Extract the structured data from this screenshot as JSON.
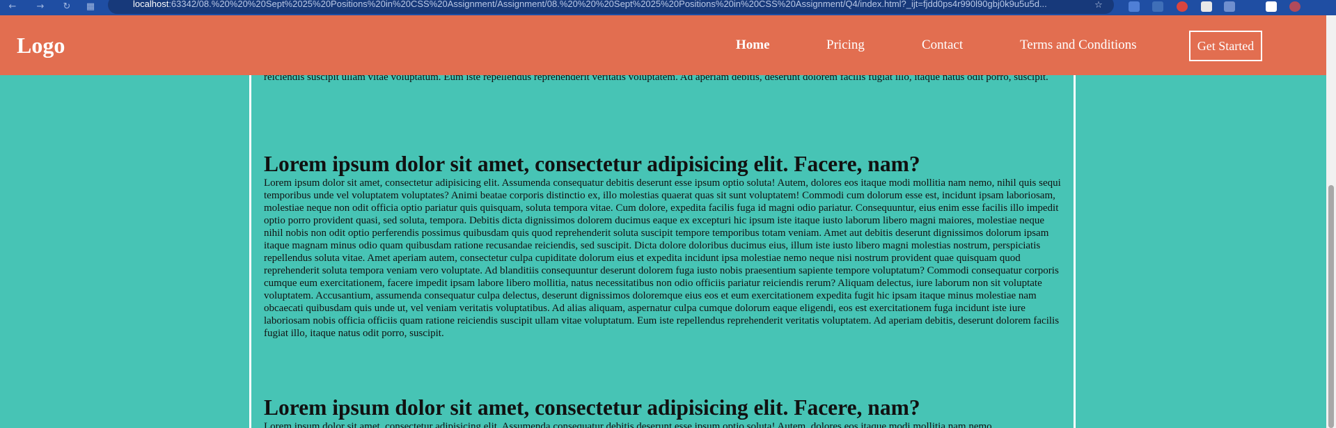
{
  "browser": {
    "url_host": "localhost",
    "url_rest": ":63342/08.%20%20%20Sept%2025%20Positions%20in%20CSS%20Assignment/Assignment/08.%20%20%20Sept%2025%20Positions%20in%20CSS%20Assignment/Q4/index.html?_ijt=fjdd0ps4r990l90gbj0k9u5u5d..."
  },
  "header": {
    "logo": "Logo",
    "nav": [
      "Home",
      "Pricing",
      "Contact",
      "Terms and Conditions"
    ],
    "cta_label": "Get Started",
    "bg_color": "#e26e50"
  },
  "page": {
    "bg_color": "#47c4b5",
    "top_paragraph_tail": "veniam veritatis voluptatibus. Ad alias aliquam, aspernatur culpa cumque dolorum eaque eligendi, eos est exercitationem fuga incidunt iste iure laboriosam nobis officia officiis quam ratione reiciendis suscipit ullam vitae voluptatum. Eum iste repellendus reprehenderit veritatis voluptatem. Ad aperiam debitis, deserunt dolorem facilis fugiat illo, itaque natus odit porro, suscipit.",
    "sections": [
      {
        "heading": "Lorem ipsum dolor sit amet, consectetur adipisicing elit. Facere, nam?",
        "body": "Lorem ipsum dolor sit amet, consectetur adipisicing elit. Assumenda consequatur debitis deserunt esse ipsum optio soluta! Autem, dolores eos itaque modi mollitia nam nemo, nihil quis sequi temporibus unde vel voluptatem voluptates? Animi beatae corporis distinctio ex, illo molestias quaerat quas sit sunt voluptatem! Commodi cum dolorum esse est, incidunt ipsam laboriosam, molestiae neque non odit officia optio pariatur quis quisquam, soluta tempora vitae. Cum dolore, expedita facilis fuga id magni odio pariatur. Consequuntur, eius enim esse facilis illo impedit optio porro provident quasi, sed soluta, tempora. Debitis dicta dignissimos dolorem ducimus eaque ex excepturi hic ipsum iste itaque iusto laborum libero magni maiores, molestiae neque nihil nobis non odit optio perferendis possimus quibusdam quis quod reprehenderit soluta suscipit tempore temporibus totam veniam. Amet aut debitis deserunt dignissimos dolorum ipsam itaque magnam minus odio quam quibusdam ratione recusandae reiciendis, sed suscipit. Dicta dolore doloribus ducimus eius, illum iste iusto libero magni molestias nostrum, perspiciatis repellendus soluta vitae. Amet aperiam autem, consectetur culpa cupiditate dolorum eius et expedita incidunt ipsa molestiae nemo neque nisi nostrum provident quae quisquam quod reprehenderit soluta tempora veniam vero voluptate. Ad blanditiis consequuntur deserunt dolorem fuga iusto nobis praesentium sapiente tempore voluptatum? Commodi consequatur corporis cumque eum exercitationem, facere impedit ipsam labore libero mollitia, natus necessitatibus non odio officiis pariatur reiciendis rerum? Aliquam delectus, iure laborum non sit voluptate voluptatem. Accusantium, assumenda consequatur culpa delectus, deserunt dignissimos doloremque eius eos et eum exercitationem expedita fugit hic ipsam itaque minus molestiae nam obcaecati quibusdam quis unde ut, vel veniam veritatis voluptatibus. Ad alias aliquam, aspernatur culpa cumque dolorum eaque eligendi, eos est exercitationem fuga incidunt iste iure laboriosam nobis officia officiis quam ratione reiciendis suscipit ullam vitae voluptatum. Eum iste repellendus reprehenderit veritatis voluptatem. Ad aperiam debitis, deserunt dolorem facilis fugiat illo, itaque natus odit porro, suscipit."
      },
      {
        "heading": "Lorem ipsum dolor sit amet, consectetur adipisicing elit. Facere, nam?",
        "body": "Lorem ipsum dolor sit amet, consectetur adipisicing elit. Assumenda consequatur debitis deserunt esse ipsum optio soluta! Autem, dolores eos itaque modi mollitia nam nemo,"
      }
    ]
  }
}
